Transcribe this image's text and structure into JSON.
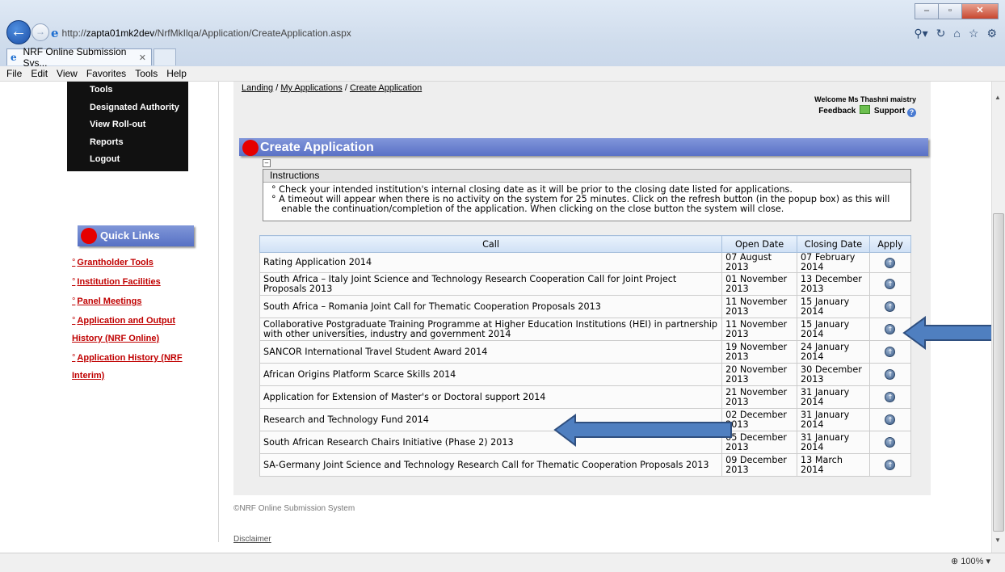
{
  "browser": {
    "url_prefix": "http://",
    "url_host": "zapta01mk2dev",
    "url_path": "/NrfMkIlqa/Application/CreateApplication.aspx",
    "tab_title": "NRF Online Submission Sys...",
    "menu": [
      "File",
      "Edit",
      "View",
      "Favorites",
      "Tools",
      "Help"
    ],
    "zoom": "100%"
  },
  "side_menu": [
    "Tools",
    "Designated Authority",
    "View Roll-out",
    "Reports",
    "Logout"
  ],
  "quick_links": {
    "title": "Quick Links",
    "items": [
      "Grantholder Tools",
      "Institution Facilities",
      "Panel Meetings",
      "Application and Output History (NRF Online)",
      "Application History (NRF Interim)"
    ]
  },
  "breadcrumb": [
    "Landing",
    "My Applications",
    "Create Application"
  ],
  "welcome": "Welcome Ms Thashni maistry",
  "feedback": "Feedback",
  "support": "Support",
  "page_title": "Create Application",
  "instructions": {
    "title": "Instructions",
    "items": [
      "Check your intended institution's internal closing date as it will be prior to the closing date listed for applications.",
      "A timeout will appear when there is no activity on the system for 25 minutes. Click on the refresh button (in the popup box) as this will enable the continuation/completion of the application. When clicking on the close button the system will close."
    ]
  },
  "table": {
    "headers": [
      "Call",
      "Open Date",
      "Closing Date",
      "Apply"
    ],
    "rows": [
      {
        "call": "Rating Application 2014",
        "open": "07 August 2013",
        "close": "07 February 2014"
      },
      {
        "call": "South Africa – Italy Joint Science and Technology Research Cooperation Call for Joint Project Proposals 2013",
        "open": "01 November 2013",
        "close": "13 December 2013"
      },
      {
        "call": "South Africa – Romania Joint Call for Thematic Cooperation Proposals 2013",
        "open": "11 November 2013",
        "close": "15 January 2014"
      },
      {
        "call": "Collaborative Postgraduate Training Programme at Higher Education Institutions (HEI) in partnership with other universities, industry and government 2014",
        "open": "11 November 2013",
        "close": "15 January 2014"
      },
      {
        "call": "SANCOR International Travel Student Award 2014",
        "open": "19 November 2013",
        "close": "24 January 2014"
      },
      {
        "call": "African Origins Platform Scarce Skills 2014",
        "open": "20 November 2013",
        "close": "30 December 2013"
      },
      {
        "call": "Application for Extension of Master's or Doctoral support 2014",
        "open": "21 November 2013",
        "close": "31 January 2014"
      },
      {
        "call": "Research and Technology Fund 2014",
        "open": "02 December 2013",
        "close": "31 January 2014"
      },
      {
        "call": "South African Research Chairs Initiative (Phase 2) 2013",
        "open": "05 December 2013",
        "close": "31 January 2014"
      },
      {
        "call": "SA-Germany Joint Science and Technology Research Call for Thematic Cooperation Proposals 2013",
        "open": "09 December 2013",
        "close": "13 March 2014"
      }
    ]
  },
  "footer": "©NRF Online Submission System",
  "disclaimer": "Disclaimer",
  "colors": {
    "header_blue": "#6a80cf",
    "dot_red": "#e60000",
    "link_red": "#c00000",
    "arrow_blue": "#4f7fc0"
  }
}
